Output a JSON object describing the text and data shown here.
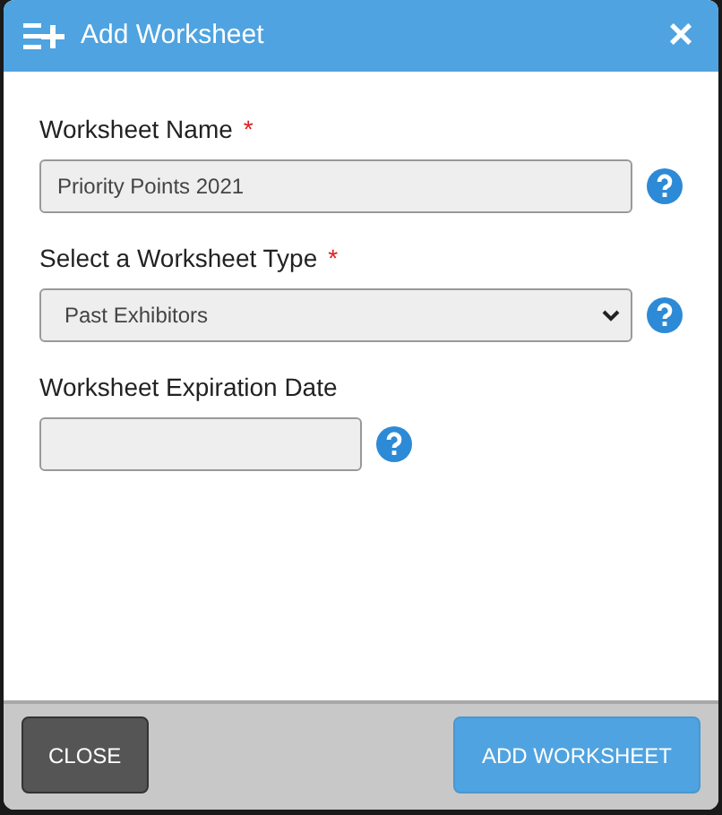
{
  "dialog": {
    "title": "Add Worksheet",
    "close_icon": "×"
  },
  "fields": [
    {
      "kind": "text",
      "label": "Worksheet Name",
      "required_mark": "*",
      "value": "Priority Points 2021"
    },
    {
      "kind": "select",
      "label": "Select a Worksheet Type",
      "required_mark": "*",
      "value": "Past Exhibitors"
    },
    {
      "kind": "date",
      "label": "Worksheet Expiration Date"
    }
  ],
  "buttons": [
    {
      "label": "CLOSE",
      "kind": "secondary"
    },
    {
      "label": "ADD WORKSHEET",
      "kind": "primary"
    }
  ]
}
